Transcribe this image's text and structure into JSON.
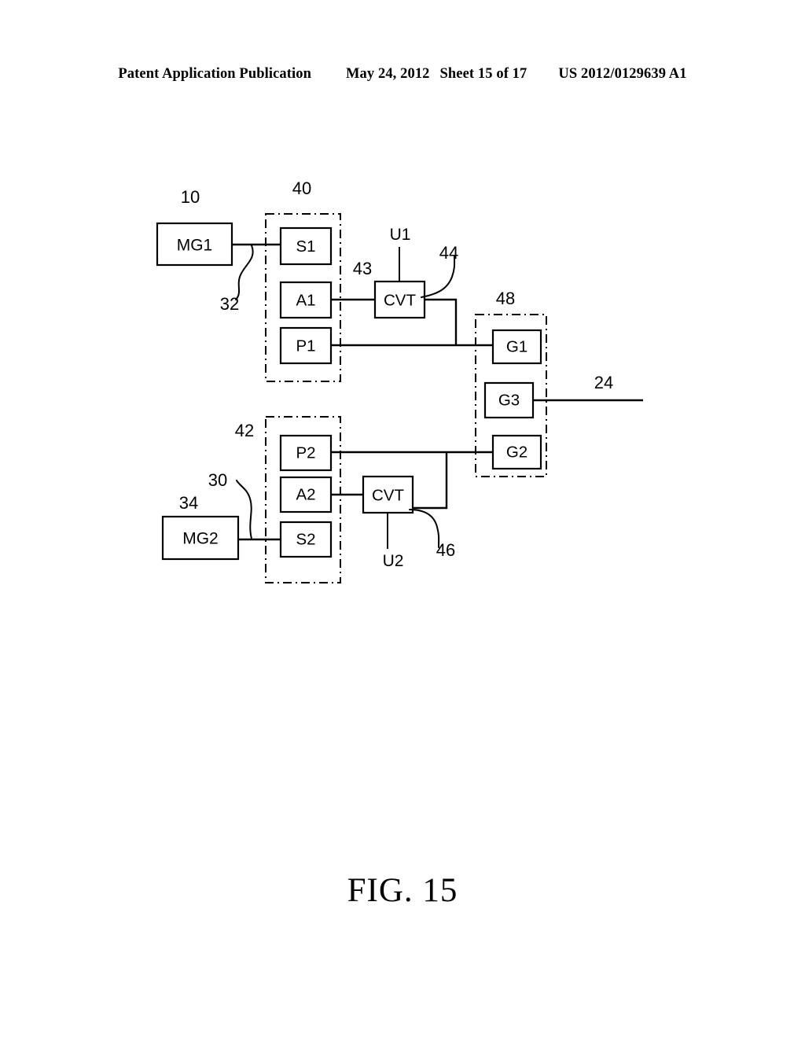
{
  "header": {
    "publication": "Patent Application Publication",
    "date": "May 24, 2012",
    "sheet": "Sheet 15 of 17",
    "patent_number": "US 2012/0129639 A1"
  },
  "figure": {
    "caption": "FIG. 15",
    "blocks": [
      {
        "id": "mg1",
        "label": "MG1"
      },
      {
        "id": "s1",
        "label": "S1"
      },
      {
        "id": "a1",
        "label": "A1"
      },
      {
        "id": "p1",
        "label": "P1"
      },
      {
        "id": "cvt1",
        "label": "CVT"
      },
      {
        "id": "g1",
        "label": "G1"
      },
      {
        "id": "g3",
        "label": "G3"
      },
      {
        "id": "g2",
        "label": "G2"
      },
      {
        "id": "p2",
        "label": "P2"
      },
      {
        "id": "a2",
        "label": "A2"
      },
      {
        "id": "s2",
        "label": "S2"
      },
      {
        "id": "cvt2",
        "label": "CVT"
      },
      {
        "id": "mg2",
        "label": "MG2"
      }
    ],
    "reference_numerals": [
      {
        "id": "n10",
        "label": "10"
      },
      {
        "id": "n40",
        "label": "40"
      },
      {
        "id": "n32",
        "label": "32"
      },
      {
        "id": "n43",
        "label": "43"
      },
      {
        "id": "n44",
        "label": "44"
      },
      {
        "id": "n48",
        "label": "48"
      },
      {
        "id": "n24",
        "label": "24"
      },
      {
        "id": "n42",
        "label": "42"
      },
      {
        "id": "n30",
        "label": "30"
      },
      {
        "id": "n34",
        "label": "34"
      },
      {
        "id": "n46",
        "label": "46"
      }
    ],
    "signal_labels": [
      {
        "id": "u1",
        "label": "U1"
      },
      {
        "id": "u2",
        "label": "U2"
      }
    ],
    "colors": {
      "ink": "#000000",
      "paper": "#ffffff"
    }
  }
}
